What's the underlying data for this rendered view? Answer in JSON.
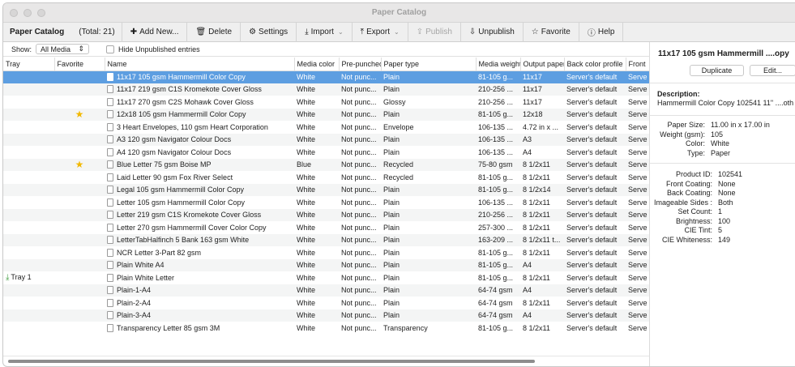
{
  "window": {
    "title": "Paper Catalog"
  },
  "toolbar": {
    "title": "Paper Catalog",
    "total": "(Total: 21)",
    "add": "Add New...",
    "delete": "Delete",
    "settings": "Settings",
    "import": "Import",
    "export": "Export",
    "publish": "Publish",
    "unpublish": "Unpublish",
    "favorite": "Favorite",
    "help": "Help"
  },
  "filter": {
    "show_label": "Show:",
    "show_value": "All Media",
    "hide_label": "Hide Unpublished entries"
  },
  "table": {
    "headers": [
      "Tray",
      "Favorite",
      "Name",
      "Media color",
      "Pre-punched",
      "Paper type",
      "Media weight",
      "Output paper",
      "Back color profile",
      "Front"
    ],
    "rows": [
      {
        "tray": "",
        "fav": false,
        "name": "11x17 105 gsm Hammermill Color Copy",
        "color": "White",
        "prepunch": "Not punc...",
        "type": "Plain",
        "weight": "81-105 g...",
        "output": "11x17",
        "profile": "Server's default",
        "front": "Serve"
      },
      {
        "tray": "",
        "fav": false,
        "name": "11x17 219 gsm C1S Kromekote Cover Gloss",
        "color": "White",
        "prepunch": "Not punc...",
        "type": "Plain",
        "weight": "210-256 ...",
        "output": "11x17",
        "profile": "Server's default",
        "front": "Serve"
      },
      {
        "tray": "",
        "fav": false,
        "name": "11x17 270 gsm C2S Mohawk Cover Gloss",
        "color": "White",
        "prepunch": "Not punc...",
        "type": "Glossy",
        "weight": "210-256 ...",
        "output": "11x17",
        "profile": "Server's default",
        "front": "Serve"
      },
      {
        "tray": "",
        "fav": true,
        "name": "12x18 105 gsm Hammermill Color Copy",
        "color": "White",
        "prepunch": "Not punc...",
        "type": "Plain",
        "weight": "81-105 g...",
        "output": "12x18",
        "profile": "Server's default",
        "front": "Serve"
      },
      {
        "tray": "",
        "fav": false,
        "name": "3 Heart Envelopes, 110 gsm Heart Corporation",
        "color": "White",
        "prepunch": "Not punc...",
        "type": "Envelope",
        "weight": "106-135 ...",
        "output": "4.72 in x ...",
        "profile": "Server's default",
        "front": "Serve"
      },
      {
        "tray": "",
        "fav": false,
        "name": "A3 120 gsm Navigator Colour Docs",
        "color": "White",
        "prepunch": "Not punc...",
        "type": "Plain",
        "weight": "106-135 ...",
        "output": "A3",
        "profile": "Server's default",
        "front": "Serve"
      },
      {
        "tray": "",
        "fav": false,
        "name": "A4 120 gsm Navigator Colour Docs",
        "color": "White",
        "prepunch": "Not punc...",
        "type": "Plain",
        "weight": "106-135 ...",
        "output": "A4",
        "profile": "Server's default",
        "front": "Serve"
      },
      {
        "tray": "",
        "fav": true,
        "name": "Blue Letter 75 gsm Boise MP",
        "color": "Blue",
        "prepunch": "Not punc...",
        "type": "Recycled",
        "weight": "75-80 gsm",
        "output": "8 1/2x11",
        "profile": "Server's default",
        "front": "Serve"
      },
      {
        "tray": "",
        "fav": false,
        "name": "Laid Letter 90 gsm Fox River Select",
        "color": "White",
        "prepunch": "Not punc...",
        "type": "Recycled",
        "weight": "81-105 g...",
        "output": "8 1/2x11",
        "profile": "Server's default",
        "front": "Serve"
      },
      {
        "tray": "",
        "fav": false,
        "name": "Legal 105 gsm Hammermill Color Copy",
        "color": "White",
        "prepunch": "Not punc...",
        "type": "Plain",
        "weight": "81-105 g...",
        "output": "8 1/2x14",
        "profile": "Server's default",
        "front": "Serve"
      },
      {
        "tray": "",
        "fav": false,
        "name": "Letter 105 gsm Hammermill Color Copy",
        "color": "White",
        "prepunch": "Not punc...",
        "type": "Plain",
        "weight": "106-135 ...",
        "output": "8 1/2x11",
        "profile": "Server's default",
        "front": "Serve"
      },
      {
        "tray": "",
        "fav": false,
        "name": "Letter 219 gsm C1S Kromekote Cover Gloss",
        "color": "White",
        "prepunch": "Not punc...",
        "type": "Plain",
        "weight": "210-256 ...",
        "output": "8 1/2x11",
        "profile": "Server's default",
        "front": "Serve"
      },
      {
        "tray": "",
        "fav": false,
        "name": "Letter 270 gsm Hammermill Cover Color Copy",
        "color": "White",
        "prepunch": "Not punc...",
        "type": "Plain",
        "weight": "257-300 ...",
        "output": "8 1/2x11",
        "profile": "Server's default",
        "front": "Serve"
      },
      {
        "tray": "",
        "fav": false,
        "name": "LetterTabHalfinch 5 Bank 163 gsm White",
        "color": "White",
        "prepunch": "Not punc...",
        "type": "Plain",
        "weight": "163-209 ...",
        "output": "8 1/2x11 t...",
        "profile": "Server's default",
        "front": "Serve"
      },
      {
        "tray": "",
        "fav": false,
        "name": "NCR Letter 3-Part 82 gsm",
        "color": "White",
        "prepunch": "Not punc...",
        "type": "Plain",
        "weight": "81-105 g...",
        "output": "8 1/2x11",
        "profile": "Server's default",
        "front": "Serve"
      },
      {
        "tray": "",
        "fav": false,
        "name": "Plain White A4",
        "color": "White",
        "prepunch": "Not punc...",
        "type": "Plain",
        "weight": "81-105 g...",
        "output": "A4",
        "profile": "Server's default",
        "front": "Serve"
      },
      {
        "tray": "Tray 1",
        "fav": false,
        "name": "Plain White Letter",
        "color": "White",
        "prepunch": "Not punc...",
        "type": "Plain",
        "weight": "81-105 g...",
        "output": "8 1/2x11",
        "profile": "Server's default",
        "front": "Serve"
      },
      {
        "tray": "",
        "fav": false,
        "name": "Plain-1-A4",
        "color": "White",
        "prepunch": "Not punc...",
        "type": "Plain",
        "weight": "64-74 gsm",
        "output": "A4",
        "profile": "Server's default",
        "front": "Serve"
      },
      {
        "tray": "",
        "fav": false,
        "name": "Plain-2-A4",
        "color": "White",
        "prepunch": "Not punc...",
        "type": "Plain",
        "weight": "64-74 gsm",
        "output": "8 1/2x11",
        "profile": "Server's default",
        "front": "Serve"
      },
      {
        "tray": "",
        "fav": false,
        "name": "Plain-3-A4",
        "color": "White",
        "prepunch": "Not punc...",
        "type": "Plain",
        "weight": "64-74 gsm",
        "output": "A4",
        "profile": "Server's default",
        "front": "Serve"
      },
      {
        "tray": "",
        "fav": false,
        "name": "Transparency Letter 85 gsm 3M",
        "color": "White",
        "prepunch": "Not punc...",
        "type": "Transparency",
        "weight": "81-105 g...",
        "output": "8 1/2x11",
        "profile": "Server's default",
        "front": "Serve"
      }
    ]
  },
  "details": {
    "title": "11x17 105 gsm Hammermill ....opy",
    "duplicate": "Duplicate",
    "edit": "Edit...",
    "description_label": "Description:",
    "description": "Hammermill Color Copy 102541 11\" ....oth",
    "group1": [
      {
        "k": "Paper Size:",
        "v": "11.00 in x 17.00 in"
      },
      {
        "k": "Weight (gsm):",
        "v": "105"
      },
      {
        "k": "Color:",
        "v": "White"
      },
      {
        "k": "Type:",
        "v": "Paper"
      }
    ],
    "group2": [
      {
        "k": "Product ID:",
        "v": "102541"
      },
      {
        "k": "Front Coating:",
        "v": "None"
      },
      {
        "k": "Back Coating:",
        "v": "None"
      },
      {
        "k": "Imageable Sides :",
        "v": "Both"
      },
      {
        "k": "Set Count:",
        "v": "1"
      },
      {
        "k": "Brightness:",
        "v": "100"
      },
      {
        "k": "CIE Tint:",
        "v": "5"
      },
      {
        "k": "CIE Whiteness:",
        "v": "149"
      }
    ]
  },
  "colors": {
    "selection": "#5d9ee1",
    "star": "#f2b800",
    "tray": "#3a9a3a"
  }
}
